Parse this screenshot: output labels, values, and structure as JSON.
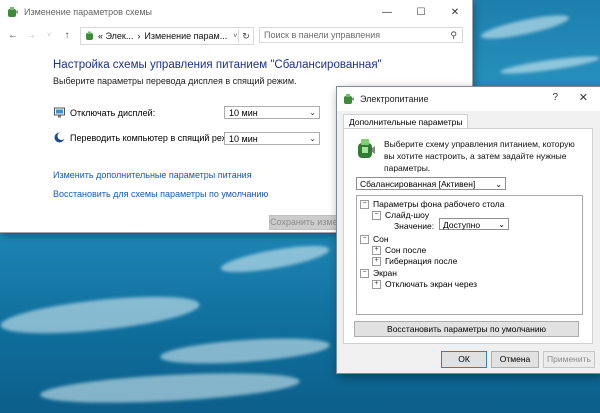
{
  "main_window": {
    "title": "Изменение параметров схемы",
    "breadcrumb_1": "« Элек...",
    "breadcrumb_sep": "›",
    "breadcrumb_2": "Изменение парам...",
    "search_placeholder": "Поиск в панели управления",
    "heading": "Настройка схемы управления питанием \"Сбалансированная\"",
    "subheading": "Выберите параметры перевода дисплея в спящий режим.",
    "display_off_label": "Отключать дисплей:",
    "display_off_value": "10 мин",
    "sleep_label": "Переводить компьютер в спящий режим:",
    "sleep_value": "10 мин",
    "link_advanced": "Изменить дополнительные параметры питания",
    "link_restore": "Восстановить для схемы параметры по умолчанию",
    "save_button": "Сохранить изменения"
  },
  "dialog": {
    "title": "Электропитание",
    "help": "?",
    "close": "✕",
    "tab": "Дополнительные параметры",
    "intro": "Выберите схему управления питанием, которую вы хотите настроить, а затем задайте нужные параметры.",
    "scheme_value": "Сбалансированная [Активен]",
    "tree": {
      "desktop_bg": "Параметры фона рабочего стола",
      "slideshow": "Слайд-шоу",
      "value_label": "Значение:",
      "value": "Доступно",
      "sleep": "Сон",
      "sleep_after": "Сон после",
      "hibernate_after": "Гибернация после",
      "screen": "Экран",
      "screen_off_after": "Отключать экран через"
    },
    "restore_defaults": "Восстановить параметры по умолчанию",
    "ok": "ОК",
    "cancel": "Отмена",
    "apply": "Применить"
  }
}
